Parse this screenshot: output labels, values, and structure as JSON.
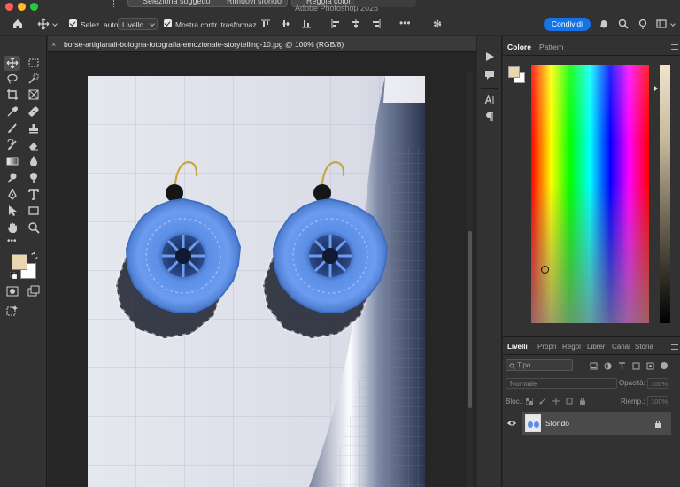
{
  "titlebar": {
    "app_title": "Adobe Photoshop 2025",
    "buttons": [
      "Seleziona soggetto",
      "Rimuovi sfondo",
      "Regola colori"
    ]
  },
  "options": {
    "auto_select_label": "Selez. auto:",
    "auto_select_value": "Livello",
    "show_transform_label": "Mostra contr. trasformaz.",
    "share_label": "Condividi"
  },
  "document": {
    "tab_title": "borse-artigianali-bologna-fotografia-emozionale-storytelling-10.jpg @ 100% (RGB/8)",
    "close_glyph": "×"
  },
  "color_panel": {
    "tabs": [
      "Colore",
      "Pattern"
    ],
    "foreground": "#e9d7b1",
    "background": "#ffffff"
  },
  "layers_panel": {
    "tabs": [
      "Livelli",
      "Propri",
      "Regol",
      "Librer",
      "Canal",
      "Storia"
    ],
    "filter_label": "Tipo",
    "blend_mode": "Normale",
    "opacity_label": "Opacità:",
    "opacity_value": "100%",
    "lock_label": "Bloc.:",
    "fill_label": "Riemp.:",
    "fill_value": "100%",
    "layer_name": "Sfondo"
  },
  "colors": {
    "accent": "#1473e6",
    "crochet_blue": "#5b8ee6"
  }
}
